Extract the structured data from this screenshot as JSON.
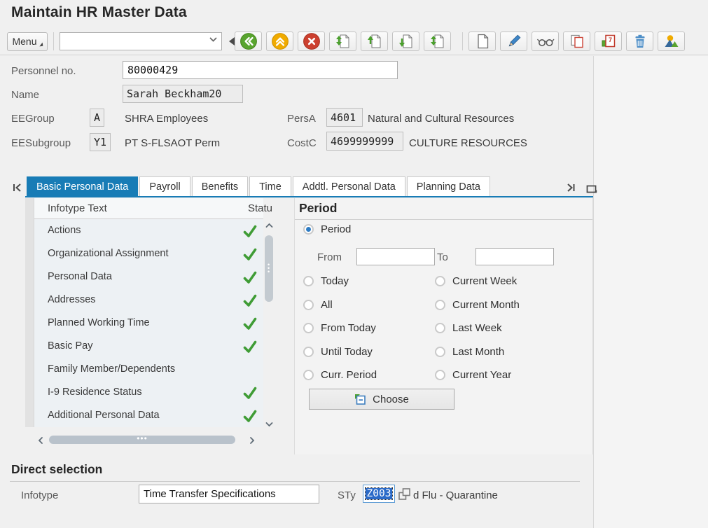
{
  "title": "Maintain HR Master Data",
  "toolbar": {
    "menu_label": "Menu",
    "command_value": "",
    "buttons": [
      "back",
      "exit",
      "cancel",
      "first-page",
      "previous-page",
      "next-page",
      "last-page",
      "create",
      "change",
      "display",
      "copy",
      "delimit",
      "delete",
      "overview"
    ]
  },
  "header_form": {
    "personnel_no": {
      "label": "Personnel no.",
      "value": "80000429"
    },
    "name": {
      "label": "Name",
      "value": "Sarah Beckham20"
    },
    "ee_group": {
      "label": "EEGroup",
      "value": "A",
      "text": "SHRA Employees"
    },
    "pers_area": {
      "label": "PersA",
      "value": "4601",
      "text": "Natural and Cultural Resources"
    },
    "ee_subgroup": {
      "label": "EESubgroup",
      "value": "Y1",
      "text": "PT S-FLSAOT Perm"
    },
    "cost_center": {
      "label": "CostC",
      "value": "4699999999",
      "text": "CULTURE RESOURCES"
    }
  },
  "tab_bar": {
    "tabs": [
      {
        "label": "Basic Personal Data",
        "active": true
      },
      {
        "label": "Payroll",
        "active": false
      },
      {
        "label": "Benefits",
        "active": false
      },
      {
        "label": "Time",
        "active": false
      },
      {
        "label": "Addtl. Personal Data",
        "active": false
      },
      {
        "label": "Planning Data",
        "active": false
      }
    ]
  },
  "infotype_table": {
    "columns": [
      "Infotype Text",
      "Statu"
    ],
    "rows": [
      {
        "text": "Actions",
        "checked": true
      },
      {
        "text": "Organizational Assignment",
        "checked": true
      },
      {
        "text": "Personal Data",
        "checked": true
      },
      {
        "text": "Addresses",
        "checked": true
      },
      {
        "text": "Planned Working Time",
        "checked": true
      },
      {
        "text": "Basic Pay",
        "checked": true
      },
      {
        "text": "Family Member/Dependents",
        "checked": false
      },
      {
        "text": "I-9 Residence Status",
        "checked": true
      },
      {
        "text": "Additional Personal Data",
        "checked": true
      }
    ]
  },
  "period_panel": {
    "title": "Period",
    "period_radio_label": "Period",
    "period_selected": true,
    "from_label": "From",
    "from_value": "",
    "to_label": "To",
    "to_value": "",
    "radio_rows": [
      {
        "left": "Today",
        "right": "Current Week"
      },
      {
        "left": "All",
        "right": "Current Month"
      },
      {
        "left": "From Today",
        "right": "Last Week"
      },
      {
        "left": "Until Today",
        "right": "Last Month"
      },
      {
        "left": "Curr. Period",
        "right": "Current Year"
      }
    ],
    "choose_button_label": "Choose"
  },
  "direct_selection": {
    "title": "Direct selection",
    "infotype_label": "Infotype",
    "infotype_value": "Time Transfer Specifications",
    "subtype_label": "STy",
    "subtype_value": "Z003",
    "subtype_text": "d Flu - Quarantine"
  },
  "colors": {
    "active_tab_blue": "#187cb6",
    "status_check_green": "#3f9c35",
    "back_green": "#59a52f",
    "exit_amber": "#f0ab00",
    "cancel_red": "#cc402f",
    "selection_blue": "#2a6ac8"
  }
}
